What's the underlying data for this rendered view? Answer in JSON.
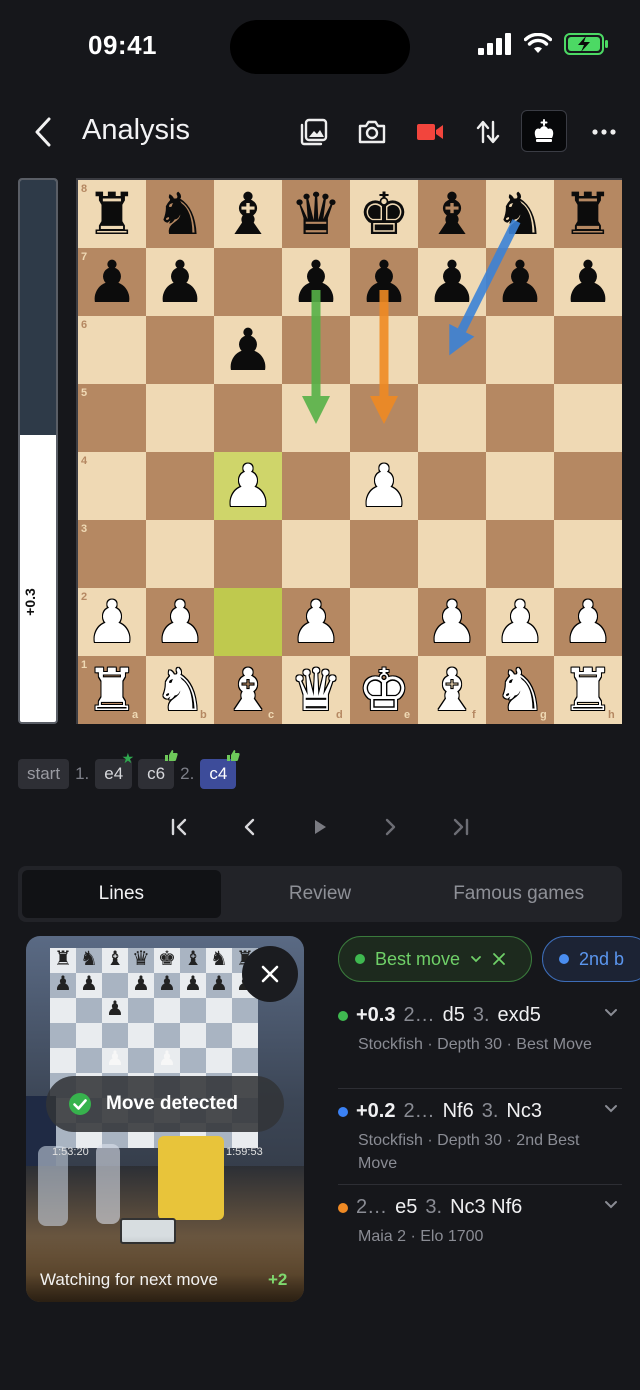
{
  "status": {
    "time": "09:41"
  },
  "header": {
    "title": "Analysis"
  },
  "eval": {
    "value": "+0.3",
    "white_fraction": 0.53
  },
  "board": {
    "ranks": [
      "8",
      "7",
      "6",
      "5",
      "4",
      "3",
      "2",
      "1"
    ],
    "files": [
      "a",
      "b",
      "c",
      "d",
      "e",
      "f",
      "g",
      "h"
    ],
    "position": [
      [
        "r",
        "n",
        "b",
        "q",
        "k",
        "b",
        "n",
        "r"
      ],
      [
        "p",
        "p",
        "",
        "p",
        "p",
        "p",
        "p",
        "p"
      ],
      [
        "",
        "",
        "p",
        "",
        "",
        "",
        "",
        ""
      ],
      [
        "",
        "",
        "",
        "",
        "",
        "",
        "",
        ""
      ],
      [
        "",
        "",
        "P",
        "",
        "P",
        "",
        "",
        ""
      ],
      [
        "",
        "",
        "",
        "",
        "",
        "",
        "",
        ""
      ],
      [
        "P",
        "P",
        "",
        "P",
        "",
        "P",
        "P",
        "P"
      ],
      [
        "R",
        "N",
        "B",
        "Q",
        "K",
        "B",
        "N",
        "R"
      ]
    ],
    "highlights": [
      "c4",
      "c2"
    ],
    "arrows": [
      {
        "from": "d7",
        "to": "d5",
        "color": "#55b047"
      },
      {
        "from": "e7",
        "to": "e5",
        "color": "#ee8a22"
      },
      {
        "from": "g8",
        "to": "f6",
        "color": "#3b82d6"
      }
    ]
  },
  "moves": {
    "start_label": "start",
    "items": [
      {
        "num": "1.",
        "white": "e4",
        "white_badge": "star",
        "black": "c6",
        "black_badge": "thumb"
      },
      {
        "num": "2.",
        "white": "c4",
        "white_badge": "thumb",
        "active": true
      }
    ]
  },
  "tabs": [
    "Lines",
    "Review",
    "Famous games"
  ],
  "camera": {
    "detected_label": "Move detected",
    "watching_label": "Watching for next move",
    "count_label": "+2",
    "clock_left": "1:53:20",
    "clock_right": "1:59:53"
  },
  "filters": {
    "best_label": "Best move",
    "second_label": "2nd b"
  },
  "lines": [
    {
      "color": "#3fb950",
      "eval": "+0.3",
      "moves": [
        [
          "2…",
          "d5"
        ],
        [
          "3.",
          "exd5"
        ]
      ],
      "sub": "Stockfish · Depth 30 · Best Move"
    },
    {
      "color": "#3b82f6",
      "eval": "+0.2",
      "moves": [
        [
          "2…",
          "Nf6"
        ],
        [
          "3.",
          "Nc3"
        ]
      ],
      "sub": "Stockfish · Depth 30 · 2nd Best Move"
    },
    {
      "color": "#f08a24",
      "eval": "",
      "moves": [
        [
          "2…",
          "e5"
        ],
        [
          "3.",
          "Nc3 Nf6"
        ]
      ],
      "sub": "Maia 2 · Elo 1700"
    }
  ]
}
